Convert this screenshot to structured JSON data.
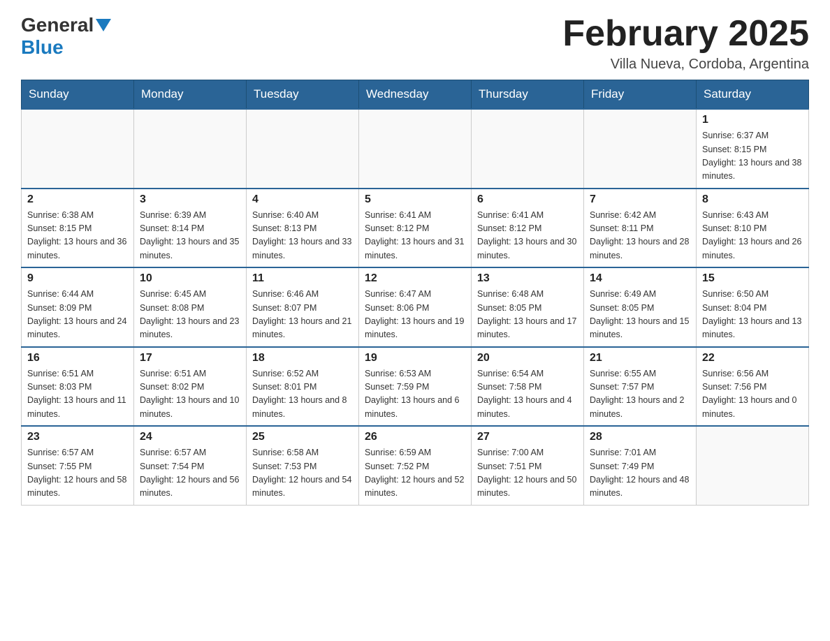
{
  "logo": {
    "line1": "General",
    "triangle_color": "#1a7abf",
    "line2": "Blue"
  },
  "header": {
    "title": "February 2025",
    "subtitle": "Villa Nueva, Cordoba, Argentina"
  },
  "weekdays": [
    "Sunday",
    "Monday",
    "Tuesday",
    "Wednesday",
    "Thursday",
    "Friday",
    "Saturday"
  ],
  "weeks": [
    [
      {
        "day": "",
        "info": ""
      },
      {
        "day": "",
        "info": ""
      },
      {
        "day": "",
        "info": ""
      },
      {
        "day": "",
        "info": ""
      },
      {
        "day": "",
        "info": ""
      },
      {
        "day": "",
        "info": ""
      },
      {
        "day": "1",
        "info": "Sunrise: 6:37 AM\nSunset: 8:15 PM\nDaylight: 13 hours and 38 minutes."
      }
    ],
    [
      {
        "day": "2",
        "info": "Sunrise: 6:38 AM\nSunset: 8:15 PM\nDaylight: 13 hours and 36 minutes."
      },
      {
        "day": "3",
        "info": "Sunrise: 6:39 AM\nSunset: 8:14 PM\nDaylight: 13 hours and 35 minutes."
      },
      {
        "day": "4",
        "info": "Sunrise: 6:40 AM\nSunset: 8:13 PM\nDaylight: 13 hours and 33 minutes."
      },
      {
        "day": "5",
        "info": "Sunrise: 6:41 AM\nSunset: 8:12 PM\nDaylight: 13 hours and 31 minutes."
      },
      {
        "day": "6",
        "info": "Sunrise: 6:41 AM\nSunset: 8:12 PM\nDaylight: 13 hours and 30 minutes."
      },
      {
        "day": "7",
        "info": "Sunrise: 6:42 AM\nSunset: 8:11 PM\nDaylight: 13 hours and 28 minutes."
      },
      {
        "day": "8",
        "info": "Sunrise: 6:43 AM\nSunset: 8:10 PM\nDaylight: 13 hours and 26 minutes."
      }
    ],
    [
      {
        "day": "9",
        "info": "Sunrise: 6:44 AM\nSunset: 8:09 PM\nDaylight: 13 hours and 24 minutes."
      },
      {
        "day": "10",
        "info": "Sunrise: 6:45 AM\nSunset: 8:08 PM\nDaylight: 13 hours and 23 minutes."
      },
      {
        "day": "11",
        "info": "Sunrise: 6:46 AM\nSunset: 8:07 PM\nDaylight: 13 hours and 21 minutes."
      },
      {
        "day": "12",
        "info": "Sunrise: 6:47 AM\nSunset: 8:06 PM\nDaylight: 13 hours and 19 minutes."
      },
      {
        "day": "13",
        "info": "Sunrise: 6:48 AM\nSunset: 8:05 PM\nDaylight: 13 hours and 17 minutes."
      },
      {
        "day": "14",
        "info": "Sunrise: 6:49 AM\nSunset: 8:05 PM\nDaylight: 13 hours and 15 minutes."
      },
      {
        "day": "15",
        "info": "Sunrise: 6:50 AM\nSunset: 8:04 PM\nDaylight: 13 hours and 13 minutes."
      }
    ],
    [
      {
        "day": "16",
        "info": "Sunrise: 6:51 AM\nSunset: 8:03 PM\nDaylight: 13 hours and 11 minutes."
      },
      {
        "day": "17",
        "info": "Sunrise: 6:51 AM\nSunset: 8:02 PM\nDaylight: 13 hours and 10 minutes."
      },
      {
        "day": "18",
        "info": "Sunrise: 6:52 AM\nSunset: 8:01 PM\nDaylight: 13 hours and 8 minutes."
      },
      {
        "day": "19",
        "info": "Sunrise: 6:53 AM\nSunset: 7:59 PM\nDaylight: 13 hours and 6 minutes."
      },
      {
        "day": "20",
        "info": "Sunrise: 6:54 AM\nSunset: 7:58 PM\nDaylight: 13 hours and 4 minutes."
      },
      {
        "day": "21",
        "info": "Sunrise: 6:55 AM\nSunset: 7:57 PM\nDaylight: 13 hours and 2 minutes."
      },
      {
        "day": "22",
        "info": "Sunrise: 6:56 AM\nSunset: 7:56 PM\nDaylight: 13 hours and 0 minutes."
      }
    ],
    [
      {
        "day": "23",
        "info": "Sunrise: 6:57 AM\nSunset: 7:55 PM\nDaylight: 12 hours and 58 minutes."
      },
      {
        "day": "24",
        "info": "Sunrise: 6:57 AM\nSunset: 7:54 PM\nDaylight: 12 hours and 56 minutes."
      },
      {
        "day": "25",
        "info": "Sunrise: 6:58 AM\nSunset: 7:53 PM\nDaylight: 12 hours and 54 minutes."
      },
      {
        "day": "26",
        "info": "Sunrise: 6:59 AM\nSunset: 7:52 PM\nDaylight: 12 hours and 52 minutes."
      },
      {
        "day": "27",
        "info": "Sunrise: 7:00 AM\nSunset: 7:51 PM\nDaylight: 12 hours and 50 minutes."
      },
      {
        "day": "28",
        "info": "Sunrise: 7:01 AM\nSunset: 7:49 PM\nDaylight: 12 hours and 48 minutes."
      },
      {
        "day": "",
        "info": ""
      }
    ]
  ]
}
